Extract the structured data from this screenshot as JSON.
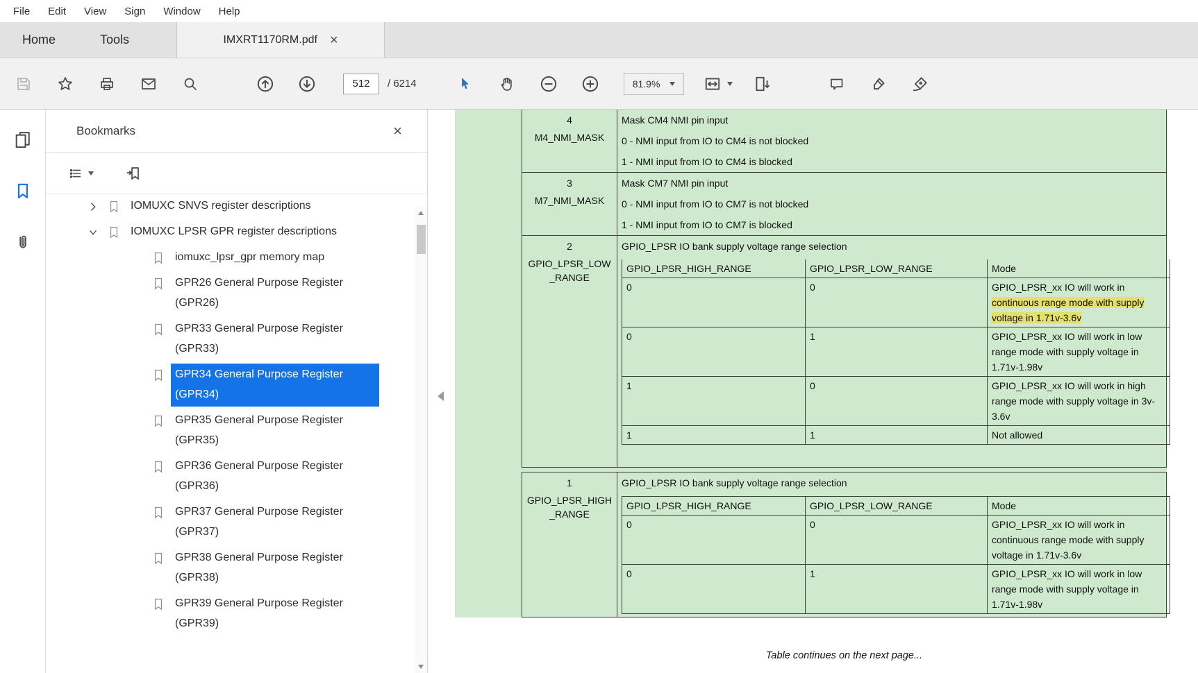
{
  "colors": {
    "accent_blue": "#1473e6",
    "table_green": "#cfe9cf",
    "highlight_yellow": "#e5e06b"
  },
  "menu": {
    "items": [
      "File",
      "Edit",
      "View",
      "Sign",
      "Window",
      "Help"
    ]
  },
  "tabs": {
    "home": "Home",
    "tools": "Tools",
    "document": "IMXRT1170RM.pdf",
    "close": "×"
  },
  "toolbar": {
    "page_current": "512",
    "page_total": "/ 6214",
    "zoom": "81.9%"
  },
  "bookmarks": {
    "title": "Bookmarks",
    "close": "×",
    "items": [
      {
        "label": "IOMUXC SNVS register descriptions"
      },
      {
        "label": "IOMUXC LPSR GPR register descriptions"
      },
      {
        "label": "iomuxc_lpsr_gpr memory map"
      },
      {
        "label": "GPR26 General Purpose Register (GPR26)"
      },
      {
        "label": "GPR33 General Purpose Register (GPR33)"
      },
      {
        "label": "GPR34 General Purpose Register (GPR34)"
      },
      {
        "label": "GPR35 General Purpose Register (GPR35)"
      },
      {
        "label": "GPR36 General Purpose Register (GPR36)"
      },
      {
        "label": "GPR37 General Purpose Register (GPR37)"
      },
      {
        "label": "GPR38 General Purpose Register (GPR38)"
      },
      {
        "label": "GPR39 General Purpose Register (GPR39)"
      }
    ]
  },
  "pdf": {
    "rows": [
      {
        "bit": "4",
        "field": "M4_NMI_MASK",
        "lines": [
          "Mask CM4 NMI pin input",
          "0 - NMI input from IO to CM4 is not blocked",
          "1 - NMI input from IO to CM4 is blocked"
        ]
      },
      {
        "bit": "3",
        "field": "M7_NMI_MASK",
        "lines": [
          "Mask CM7 NMI pin input",
          "0 - NMI input from IO to CM7 is not blocked",
          "1 - NMI input from IO to CM7 is blocked"
        ]
      },
      {
        "bit": "2",
        "field": "GPIO_LPSR_LOW_RANGE",
        "desc": "GPIO_LPSR IO bank supply voltage range selection",
        "table": {
          "headers": [
            "GPIO_LPSR_HIGH_RANGE",
            "GPIO_LPSR_LOW_RANGE",
            "Mode"
          ],
          "rows": [
            {
              "high": "0",
              "low": "0",
              "mode_pre": "GPIO_LPSR_xx IO will work in ",
              "mode_highlight": "continuous range mode with supply voltage in 1.71v-3.6v"
            },
            {
              "high": "0",
              "low": "1",
              "mode": "GPIO_LPSR_xx IO will work in low range mode with supply voltage in 1.71v-1.98v"
            },
            {
              "high": "1",
              "low": "0",
              "mode": "GPIO_LPSR_xx IO will work in high range mode with supply voltage in 3v-3.6v"
            },
            {
              "high": "1",
              "low": "1",
              "mode": "Not allowed"
            }
          ]
        }
      },
      {
        "bit": "1",
        "field": "GPIO_LPSR_HIGH_RANGE",
        "desc": "GPIO_LPSR IO bank supply voltage range selection",
        "table": {
          "headers": [
            "GPIO_LPSR_HIGH_RANGE",
            "GPIO_LPSR_LOW_RANGE",
            "Mode"
          ],
          "rows": [
            {
              "high": "0",
              "low": "0",
              "mode": "GPIO_LPSR_xx IO will work in continuous range mode with supply voltage in 1.71v-3.6v"
            },
            {
              "high": "0",
              "low": "1",
              "mode": "GPIO_LPSR_xx IO will work in low range mode with supply voltage in 1.71v-1.98v"
            }
          ]
        }
      }
    ],
    "continues": "Table continues on the next page..."
  }
}
